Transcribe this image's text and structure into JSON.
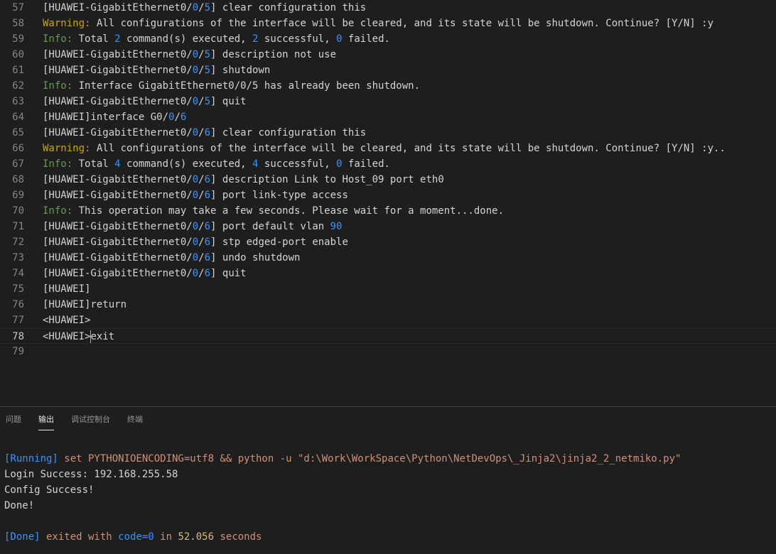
{
  "editor": {
    "lines": [
      {
        "n": "57",
        "segs": [
          [
            "t",
            "[HUAWEI-GigabitEthernet0/"
          ],
          [
            "n",
            "0"
          ],
          [
            "t",
            "/"
          ],
          [
            "n",
            "5"
          ],
          [
            "t",
            "] clear configuration this"
          ]
        ]
      },
      {
        "n": "58",
        "segs": [
          [
            "w",
            "Warning:"
          ],
          [
            "t",
            " All configurations of the interface will be cleared, and its state will be shutdown. Continue? [Y/N] :y"
          ]
        ]
      },
      {
        "n": "59",
        "segs": [
          [
            "i",
            "Info:"
          ],
          [
            "t",
            " Total "
          ],
          [
            "n",
            "2"
          ],
          [
            "t",
            " command(s) executed, "
          ],
          [
            "n",
            "2"
          ],
          [
            "t",
            " successful, "
          ],
          [
            "n",
            "0"
          ],
          [
            "t",
            " failed."
          ]
        ]
      },
      {
        "n": "60",
        "segs": [
          [
            "t",
            "[HUAWEI-GigabitEthernet0/"
          ],
          [
            "n",
            "0"
          ],
          [
            "t",
            "/"
          ],
          [
            "n",
            "5"
          ],
          [
            "t",
            "] description not use"
          ]
        ]
      },
      {
        "n": "61",
        "segs": [
          [
            "t",
            "[HUAWEI-GigabitEthernet0/"
          ],
          [
            "n",
            "0"
          ],
          [
            "t",
            "/"
          ],
          [
            "n",
            "5"
          ],
          [
            "t",
            "] shutdown"
          ]
        ]
      },
      {
        "n": "62",
        "segs": [
          [
            "i",
            "Info:"
          ],
          [
            "t",
            " Interface GigabitEthernet0/0/5 has already been shutdown."
          ]
        ]
      },
      {
        "n": "63",
        "segs": [
          [
            "t",
            "[HUAWEI-GigabitEthernet0/"
          ],
          [
            "n",
            "0"
          ],
          [
            "t",
            "/"
          ],
          [
            "n",
            "5"
          ],
          [
            "t",
            "] quit"
          ]
        ]
      },
      {
        "n": "64",
        "segs": [
          [
            "t",
            "[HUAWEI]interface G0/"
          ],
          [
            "n",
            "0"
          ],
          [
            "t",
            "/"
          ],
          [
            "n",
            "6"
          ]
        ]
      },
      {
        "n": "65",
        "segs": [
          [
            "t",
            "[HUAWEI-GigabitEthernet0/"
          ],
          [
            "n",
            "0"
          ],
          [
            "t",
            "/"
          ],
          [
            "n",
            "6"
          ],
          [
            "t",
            "] clear configuration this"
          ]
        ]
      },
      {
        "n": "66",
        "segs": [
          [
            "w",
            "Warning:"
          ],
          [
            "t",
            " All configurations of the interface will be cleared, and its state will be shutdown. Continue? [Y/N] :y.."
          ]
        ]
      },
      {
        "n": "67",
        "segs": [
          [
            "i",
            "Info:"
          ],
          [
            "t",
            " Total "
          ],
          [
            "n",
            "4"
          ],
          [
            "t",
            " command(s) executed, "
          ],
          [
            "n",
            "4"
          ],
          [
            "t",
            " successful, "
          ],
          [
            "n",
            "0"
          ],
          [
            "t",
            " failed."
          ]
        ]
      },
      {
        "n": "68",
        "segs": [
          [
            "t",
            "[HUAWEI-GigabitEthernet0/"
          ],
          [
            "n",
            "0"
          ],
          [
            "t",
            "/"
          ],
          [
            "n",
            "6"
          ],
          [
            "t",
            "] description Link to Host_09 port eth0"
          ]
        ]
      },
      {
        "n": "69",
        "segs": [
          [
            "t",
            "[HUAWEI-GigabitEthernet0/"
          ],
          [
            "n",
            "0"
          ],
          [
            "t",
            "/"
          ],
          [
            "n",
            "6"
          ],
          [
            "t",
            "] port link-type access"
          ]
        ]
      },
      {
        "n": "70",
        "segs": [
          [
            "i",
            "Info:"
          ],
          [
            "t",
            " This operation may take a few seconds. Please wait for a moment...done."
          ]
        ]
      },
      {
        "n": "71",
        "segs": [
          [
            "t",
            "[HUAWEI-GigabitEthernet0/"
          ],
          [
            "n",
            "0"
          ],
          [
            "t",
            "/"
          ],
          [
            "n",
            "6"
          ],
          [
            "t",
            "] port default vlan "
          ],
          [
            "n",
            "90"
          ]
        ]
      },
      {
        "n": "72",
        "segs": [
          [
            "t",
            "[HUAWEI-GigabitEthernet0/"
          ],
          [
            "n",
            "0"
          ],
          [
            "t",
            "/"
          ],
          [
            "n",
            "6"
          ],
          [
            "t",
            "] stp edged-port enable"
          ]
        ]
      },
      {
        "n": "73",
        "segs": [
          [
            "t",
            "[HUAWEI-GigabitEthernet0/"
          ],
          [
            "n",
            "0"
          ],
          [
            "t",
            "/"
          ],
          [
            "n",
            "6"
          ],
          [
            "t",
            "] undo shutdown"
          ]
        ]
      },
      {
        "n": "74",
        "segs": [
          [
            "t",
            "[HUAWEI-GigabitEthernet0/"
          ],
          [
            "n",
            "0"
          ],
          [
            "t",
            "/"
          ],
          [
            "n",
            "6"
          ],
          [
            "t",
            "] quit"
          ]
        ]
      },
      {
        "n": "75",
        "segs": [
          [
            "t",
            "[HUAWEI]"
          ]
        ]
      },
      {
        "n": "76",
        "segs": [
          [
            "t",
            "[HUAWEI]return"
          ]
        ]
      },
      {
        "n": "77",
        "segs": [
          [
            "t",
            "<HUAWEI>"
          ]
        ]
      },
      {
        "n": "78",
        "segs": [
          [
            "t",
            "<HUAWEI>"
          ],
          [
            "c",
            ""
          ],
          [
            "t",
            "exit"
          ]
        ],
        "active": true
      },
      {
        "n": "79",
        "segs": []
      }
    ]
  },
  "panel": {
    "tabs": [
      "问题",
      "输出",
      "调试控制台",
      "终端"
    ],
    "active_tab": "输出",
    "output": {
      "running_tag": "[Running]",
      "running_cmd": " set PYTHONIOENCODING=utf8 && python -u \"d:\\Work\\WorkSpace\\Python\\NetDevOps\\_Jinja2\\jinja2_2_netmiko.py\"",
      "login": "Login Success: 192.168.255.58",
      "config": "Config Success!",
      "done": "Done!",
      "done_tag": "[Done]",
      "exited_prefix": " exited with ",
      "code": "code=0",
      "in_text": " in ",
      "seconds_value": "52.056",
      "seconds_label": " seconds"
    }
  },
  "colors": {
    "warning": "#cca700",
    "info": "#6a9955",
    "number": "#3794ff",
    "bg": "#1e1e1e"
  }
}
